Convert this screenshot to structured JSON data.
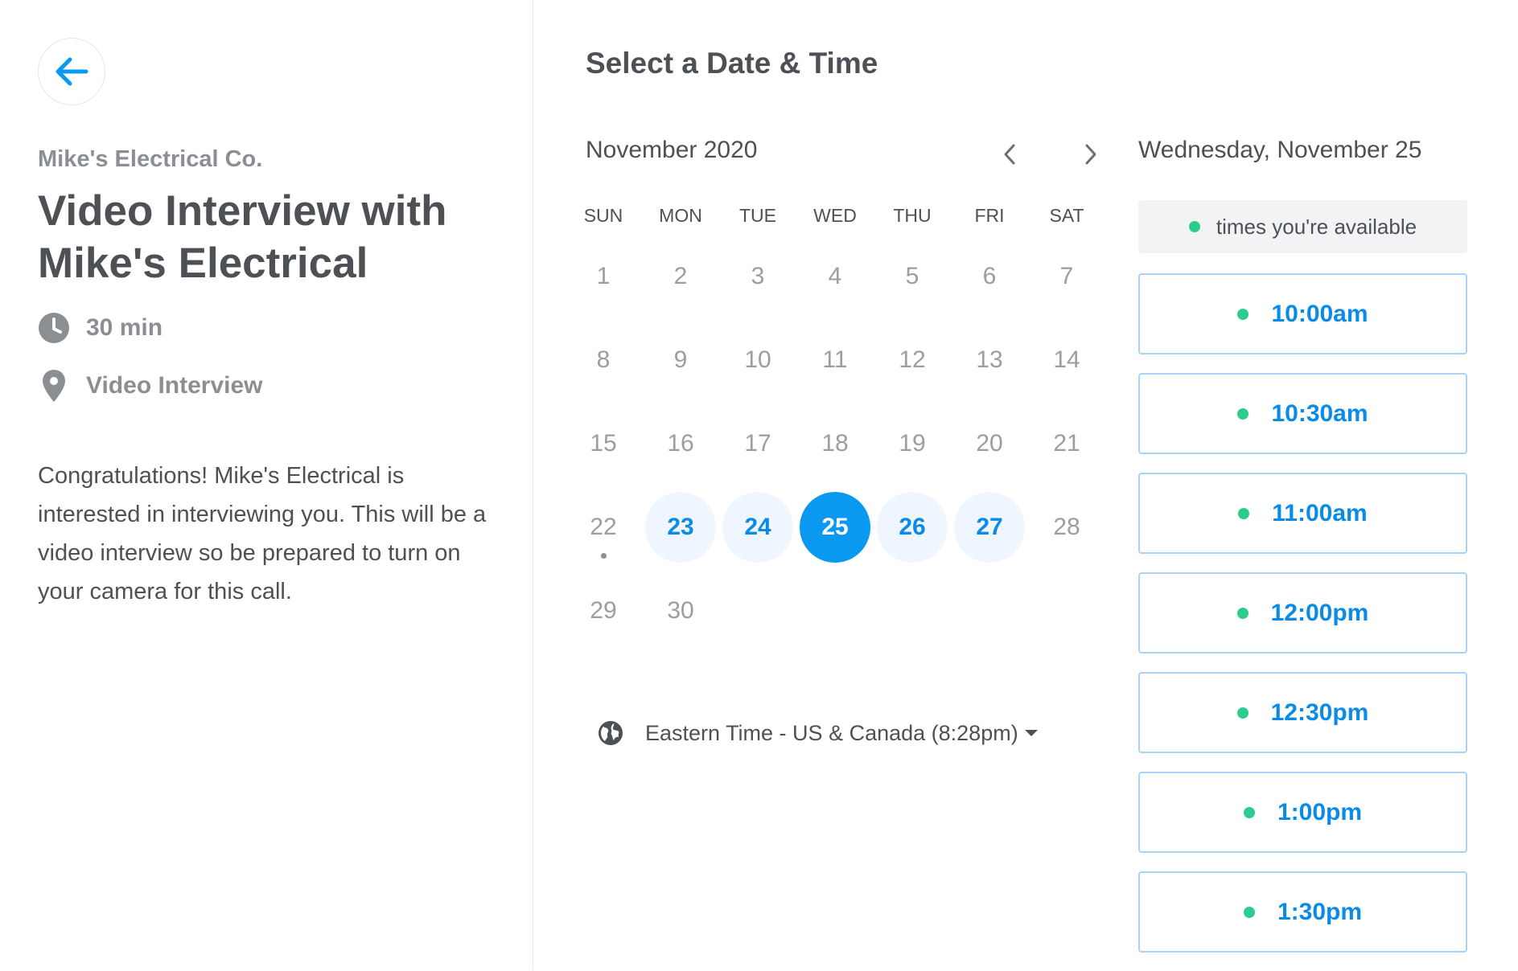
{
  "event": {
    "organization": "Mike's Electrical Co.",
    "title": "Video Interview with Mike's Electrical",
    "duration": "30 min",
    "location": "Video Interview",
    "description": "Congratulations! Mike's Electrical is interested in interviewing you. This will be a video interview so be prepared to turn on your camera for this call."
  },
  "scheduler": {
    "heading": "Select a Date & Time",
    "month_label": "November 2020",
    "weekdays": [
      "SUN",
      "MON",
      "TUE",
      "WED",
      "THU",
      "FRI",
      "SAT"
    ],
    "weeks": [
      [
        "1",
        "2",
        "3",
        "4",
        "5",
        "6",
        "7"
      ],
      [
        "8",
        "9",
        "10",
        "11",
        "12",
        "13",
        "14"
      ],
      [
        "15",
        "16",
        "17",
        "18",
        "19",
        "20",
        "21"
      ],
      [
        "22",
        "23",
        "24",
        "25",
        "26",
        "27",
        "28"
      ],
      [
        "29",
        "30",
        "",
        "",
        "",
        "",
        ""
      ]
    ],
    "available_days": [
      "23",
      "24",
      "25",
      "26",
      "27"
    ],
    "selected_day": "25",
    "today": "22",
    "timezone": "Eastern Time - US & Canada (8:28pm)"
  },
  "times": {
    "selected_date_label": "Wednesday, November 25",
    "legend": "times you're available",
    "slots": [
      "10:00am",
      "10:30am",
      "11:00am",
      "12:00pm",
      "12:30pm",
      "1:00pm",
      "1:30pm"
    ]
  },
  "colors": {
    "accent": "#0a99f0",
    "available_bg": "#f0f6ff",
    "available_dot": "#2bcc8c",
    "text": "#4d5055",
    "muted": "#8b8f94"
  },
  "icons": {
    "back": "arrow-left-icon",
    "duration": "clock-icon",
    "location": "map-pin-icon",
    "timezone": "globe-icon"
  }
}
